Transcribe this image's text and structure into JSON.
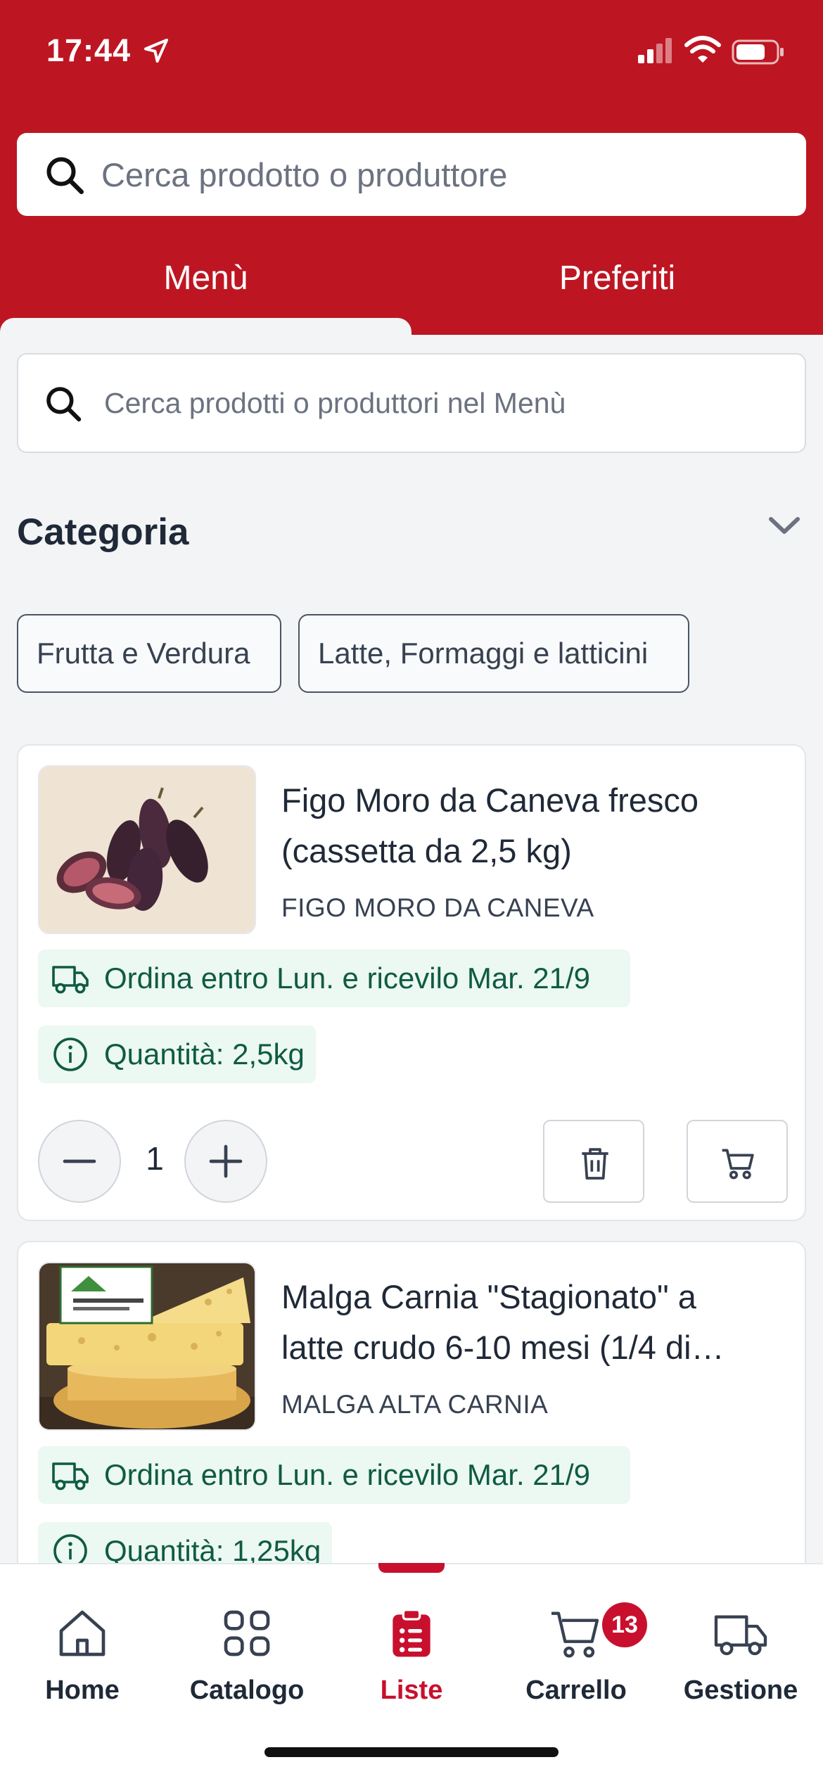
{
  "status_bar": {
    "time": "17:44"
  },
  "search": {
    "placeholder": "Cerca prodotto o produttore"
  },
  "tabs": [
    {
      "label": "Menù",
      "active": true
    },
    {
      "label": "Preferiti",
      "active": false
    }
  ],
  "menu_search": {
    "placeholder": "Cerca prodotti o produttori nel Menù"
  },
  "category": {
    "title": "Categoria",
    "chips": [
      "Frutta e Verdura",
      "Latte, Formaggi e latticini"
    ]
  },
  "products": [
    {
      "title": "Figo Moro da Caneva fresco (cassetta da 2,5 kg)",
      "producer": "FIGO MORO DA CANEVA",
      "delivery": "Ordina entro Lun. e ricevilo Mar. 21/9",
      "quantity": "Quantità: 2,5kg",
      "count": "1"
    },
    {
      "title": "Malga Carnia \"Stagionato\" a latte crudo 6-10 mesi (1/4 di…",
      "producer": "MALGA ALTA CARNIA",
      "delivery": "Ordina entro Lun. e ricevilo Mar. 21/9",
      "quantity": "Quantità: 1,25kg"
    }
  ],
  "bottom_nav": {
    "items": [
      {
        "label": "Home",
        "icon": "home-icon"
      },
      {
        "label": "Catalogo",
        "icon": "grid-icon"
      },
      {
        "label": "Liste",
        "icon": "clipboard-list-icon",
        "active": true
      },
      {
        "label": "Carrello",
        "icon": "cart-icon",
        "badge": "13"
      },
      {
        "label": "Gestione",
        "icon": "truck-icon"
      }
    ]
  },
  "colors": {
    "brand": "#bd1622",
    "accent": "#c8102e",
    "success_bg": "#ecf8f2",
    "success_text": "#0f5b43"
  }
}
